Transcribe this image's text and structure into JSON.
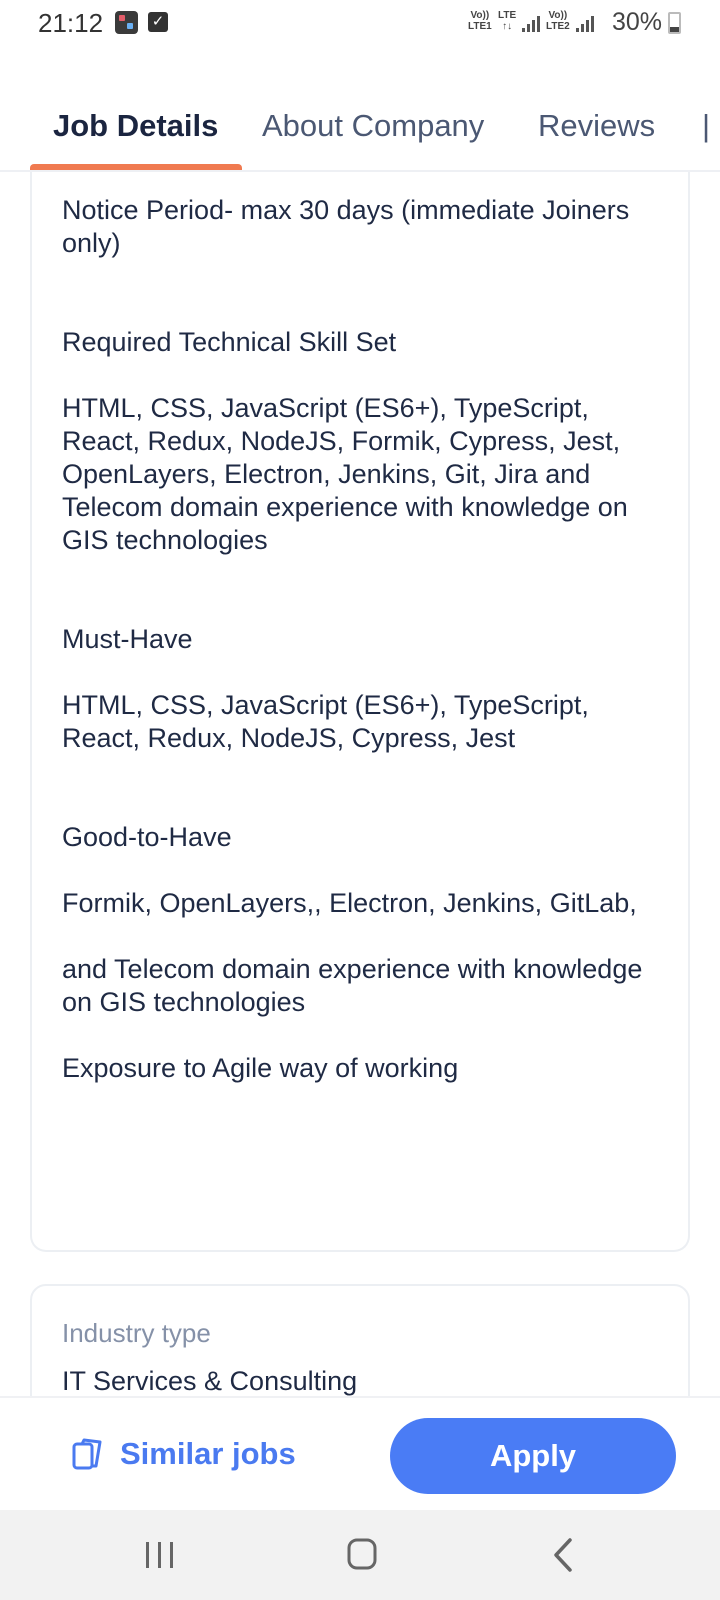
{
  "status_bar": {
    "time": "21:12",
    "network_1_top": "Vo))",
    "network_1_bottom": "LTE1",
    "network_lte": "LTE",
    "network_2_top": "Vo))",
    "network_2_bottom": "LTE2",
    "battery": "30%",
    "icons": [
      "app-notification-icon",
      "task-check-icon",
      "signal-icon",
      "battery-icon"
    ]
  },
  "tabs": [
    {
      "label": "Job Details",
      "active": true
    },
    {
      "label": "About Company",
      "active": false
    },
    {
      "label": "Reviews",
      "active": false
    }
  ],
  "description": {
    "notice_period": "Notice Period- max 30 days (immediate Joiners only)",
    "required_heading": "Required Technical Skill Set",
    "required_skills": "HTML, CSS, JavaScript (ES6+), TypeScript, React, Redux, NodeJS, Formik, Cypress, Jest, OpenLayers, Electron, Jenkins, Git, Jira and Telecom domain experience with knowledge on GIS technologies",
    "must_have_heading": "Must-Have",
    "must_have_skills": "HTML, CSS, JavaScript (ES6+), TypeScript, React, Redux, NodeJS, Cypress, Jest",
    "good_to_have_heading": "Good-to-Have",
    "good_to_have_skills": "Formik, OpenLayers,, Electron, Jenkins, GitLab,",
    "telecom_note": "and Telecom domain experience with knowledge on GIS technologies",
    "agile_note": "Exposure to Agile way of working"
  },
  "industry": {
    "label": "Industry type",
    "value": "IT Services & Consulting"
  },
  "actions": {
    "similar_jobs_label": "Similar jobs",
    "apply_label": "Apply"
  },
  "colors": {
    "accent": "#f07a50",
    "primary": "#4a7cf5",
    "text": "#1f2a44",
    "muted": "#8591a8"
  }
}
